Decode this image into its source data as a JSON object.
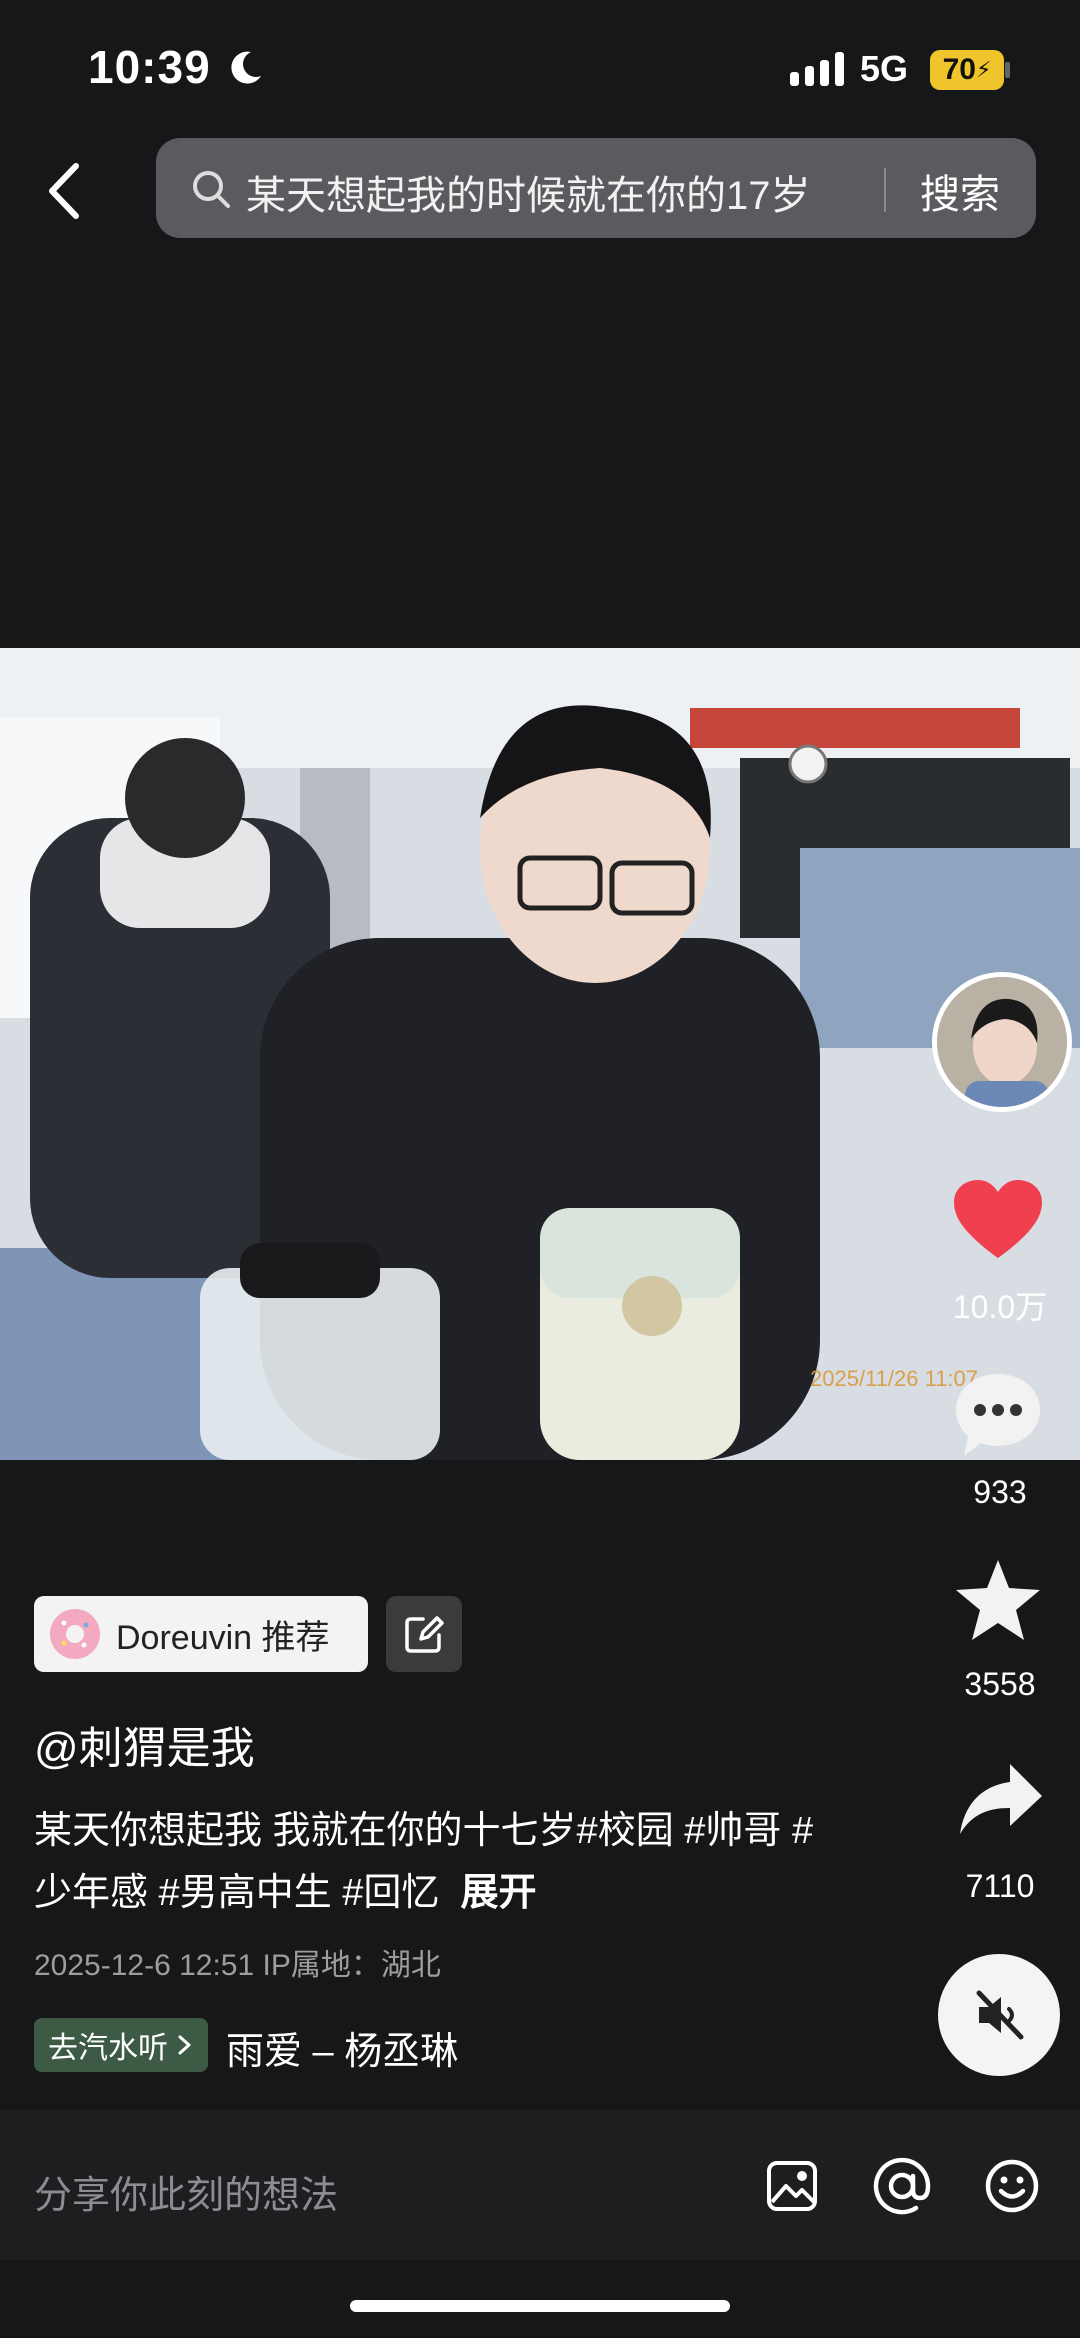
{
  "status_bar": {
    "time": "10:39",
    "network": "5G",
    "battery": "70"
  },
  "header": {
    "search_text": "某天想起我的时候就在你的17岁",
    "search_button": "搜索"
  },
  "photo": {
    "timestamp": "2025/11/26 11:07"
  },
  "rail": {
    "likes": "10.0万",
    "comments": "933",
    "favorites": "3558",
    "shares": "7110"
  },
  "post": {
    "recommend_label": "Doreuvin 推荐",
    "author": "@刺猬是我",
    "caption": "某天你想起我 我就在你的十七岁#校园 #帅哥 #少年感 #男高中生 #回忆",
    "expand_label": "展开",
    "meta": "2025-12-6 12:51  IP属地：湖北",
    "music_chip": "去汽水听",
    "music_title": "雨爱 – 杨丞琳"
  },
  "input": {
    "placeholder": "分享你此刻的想法"
  },
  "colors": {
    "background": "#161719",
    "like": "#f0404f",
    "music_chip": "#3d5a45",
    "battery": "#f0c42b"
  }
}
